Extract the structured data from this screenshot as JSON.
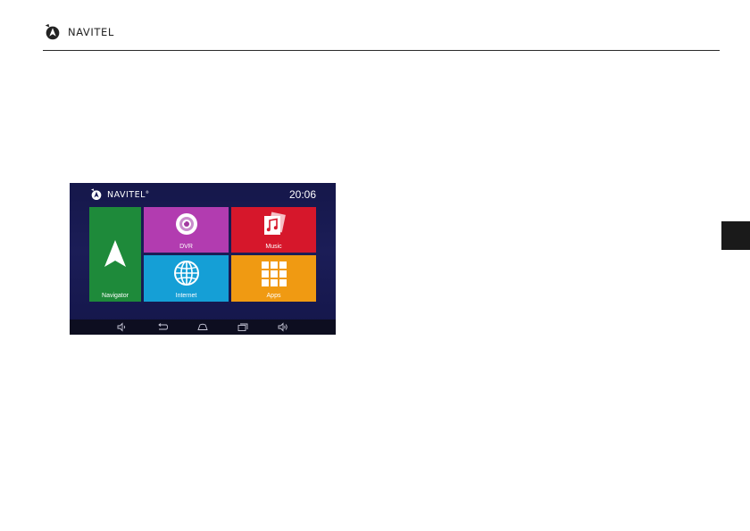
{
  "header": {
    "brand": "NAVITEL",
    "logo_icon": "navitel-logo-icon"
  },
  "device": {
    "brand": "NAVITEL",
    "brand_mark": "®",
    "time": "20:06",
    "tiles": {
      "navigator": {
        "label": "Navigator",
        "color": "#1e8a3a",
        "icon": "navigation-arrow-icon"
      },
      "dvr": {
        "label": "DVR",
        "color": "#b23cb0",
        "icon": "camera-lens-icon"
      },
      "music": {
        "label": "Music",
        "color": "#d6172b",
        "icon": "music-note-icon"
      },
      "internet": {
        "label": "Internet",
        "color": "#159fd6",
        "icon": "globe-icon"
      },
      "apps": {
        "label": "Apps",
        "color": "#f09a12",
        "icon": "app-grid-icon"
      }
    },
    "nav_bar": [
      "volume-down-icon",
      "back-icon",
      "home-icon",
      "recent-apps-icon",
      "volume-up-icon"
    ]
  },
  "side_tab_color": "#1a1a1a"
}
